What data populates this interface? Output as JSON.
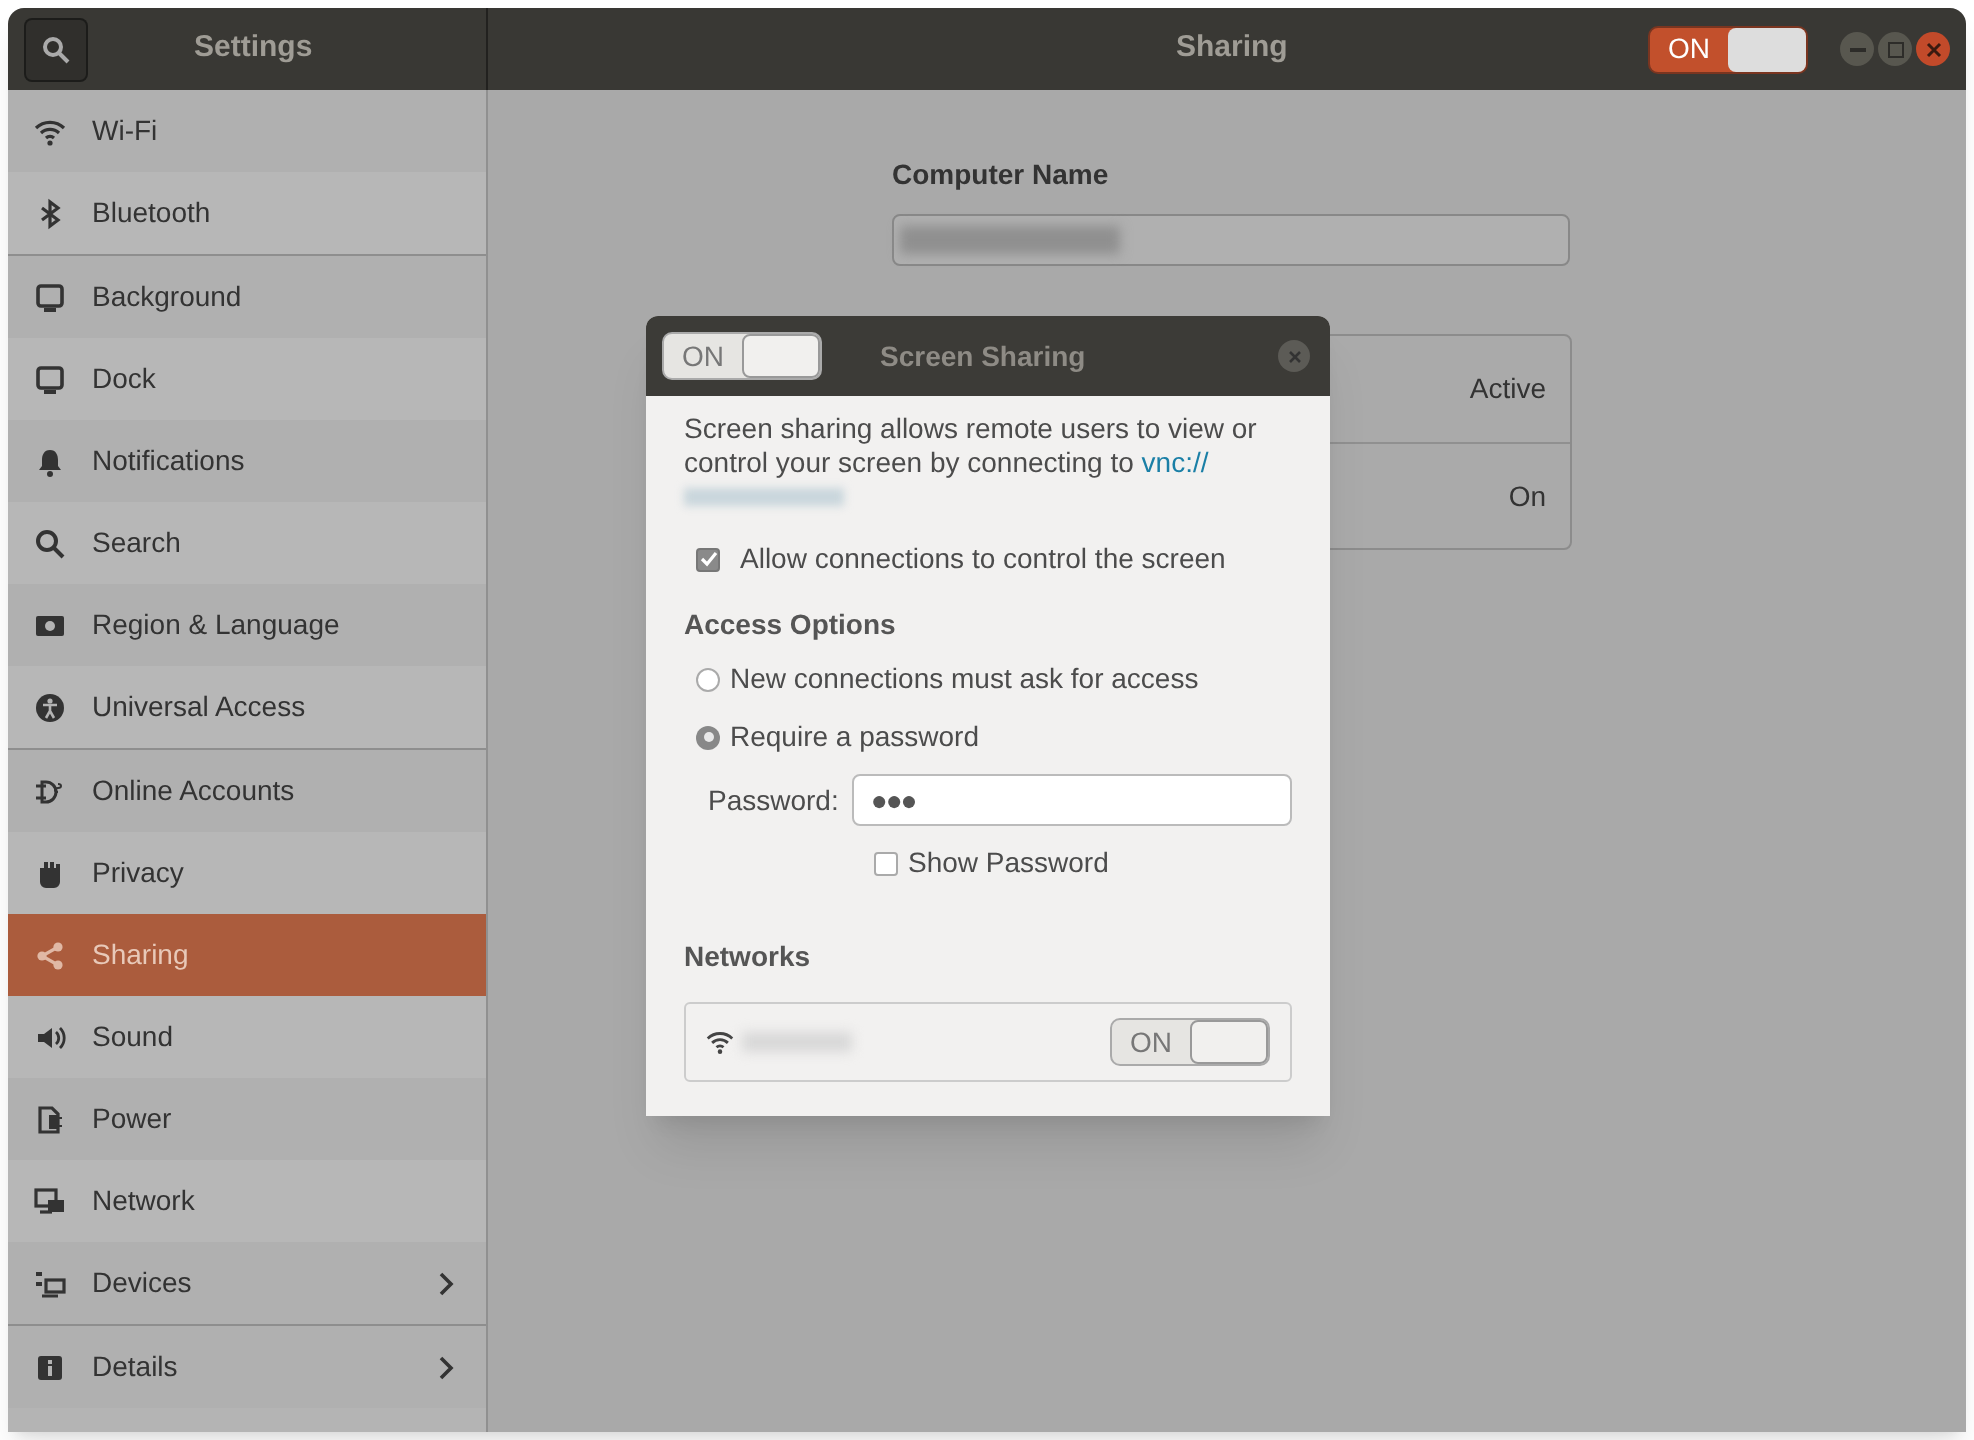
{
  "header": {
    "sidebar_title": "Settings",
    "title": "Sharing",
    "toggle": {
      "label": "ON",
      "on": true
    }
  },
  "sidebar": {
    "groups": [
      [
        {
          "kind": "wifi",
          "label": "Wi-Fi",
          "selected": false,
          "arrow": false
        },
        {
          "kind": "bluetooth",
          "label": "Bluetooth",
          "selected": false,
          "arrow": false
        }
      ],
      [
        {
          "kind": "monitor",
          "label": "Background",
          "selected": false,
          "arrow": false
        },
        {
          "kind": "monitor",
          "label": "Dock",
          "selected": false,
          "arrow": false
        },
        {
          "kind": "bell",
          "label": "Notifications",
          "selected": false,
          "arrow": false
        },
        {
          "kind": "search",
          "label": "Search",
          "selected": false,
          "arrow": false
        },
        {
          "kind": "flag",
          "label": "Region & Language",
          "selected": false,
          "arrow": false
        },
        {
          "kind": "person",
          "label": "Universal Access",
          "selected": false,
          "arrow": false
        }
      ],
      [
        {
          "kind": "accounts",
          "label": "Online Accounts",
          "selected": false,
          "arrow": false
        },
        {
          "kind": "hand",
          "label": "Privacy",
          "selected": false,
          "arrow": false
        },
        {
          "kind": "share",
          "label": "Sharing",
          "selected": true,
          "arrow": false
        },
        {
          "kind": "speaker",
          "label": "Sound",
          "selected": false,
          "arrow": false
        },
        {
          "kind": "power",
          "label": "Power",
          "selected": false,
          "arrow": false
        },
        {
          "kind": "network",
          "label": "Network",
          "selected": false,
          "arrow": false
        },
        {
          "kind": "devices",
          "label": "Devices",
          "selected": false,
          "arrow": true
        }
      ],
      [
        {
          "kind": "info",
          "label": "Details",
          "selected": false,
          "arrow": true
        }
      ]
    ]
  },
  "content": {
    "computer_name_label": "Computer Name",
    "services": [
      {
        "status": "Active"
      },
      {
        "status": "On"
      }
    ]
  },
  "dialog": {
    "title": "Screen Sharing",
    "toggle": {
      "label": "ON",
      "on": true
    },
    "description": "Screen sharing allows remote users to view or control your screen by connecting to ",
    "link": "vnc://",
    "allow_control": {
      "label": "Allow connections to control the screen",
      "checked": true
    },
    "access_heading": "Access Options",
    "access_options": [
      {
        "label": "New connections must ask for access",
        "selected": false
      },
      {
        "label": "Require a password",
        "selected": true
      }
    ],
    "password_label": "Password:",
    "password_value": "●●●",
    "show_password": {
      "label": "Show Password",
      "checked": false
    },
    "networks_heading": "Networks",
    "networks": [
      {
        "toggle": {
          "label": "ON",
          "on": true
        }
      }
    ]
  }
}
